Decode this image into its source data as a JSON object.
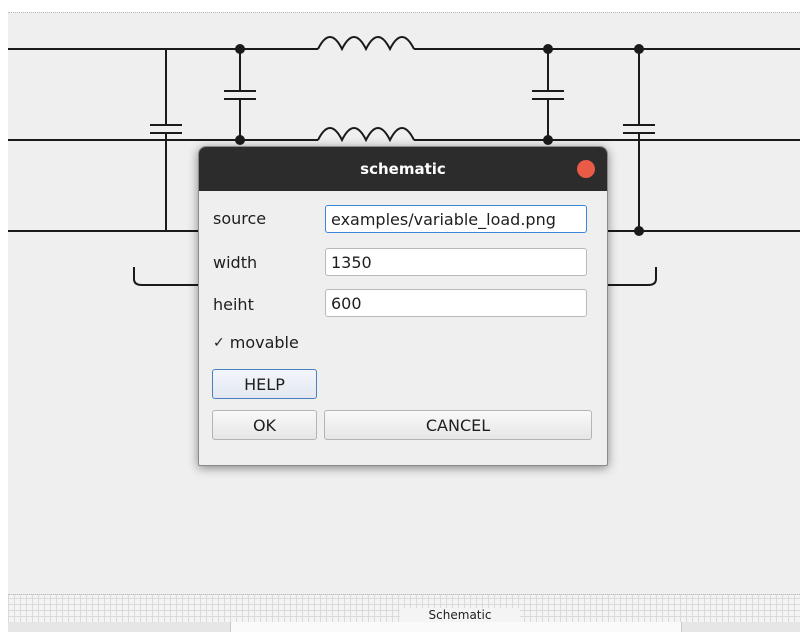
{
  "dialog": {
    "title": "schematic",
    "fields": [
      {
        "label": "source",
        "value": "examples/variable_load.png"
      },
      {
        "label": "width",
        "value": "1350"
      },
      {
        "label": "heiht",
        "value": "600"
      }
    ],
    "checkbox": {
      "label": "movable",
      "checked": true,
      "mark": "✓"
    },
    "help_label": "HELP",
    "ok_label": "OK",
    "cancel_label": "CANCEL"
  },
  "bottom_tab": {
    "label": "Schematic"
  },
  "colors": {
    "close_button": "#e95a47",
    "titlebar": "#2c2c2c",
    "focus_border": "#3b86d8"
  }
}
